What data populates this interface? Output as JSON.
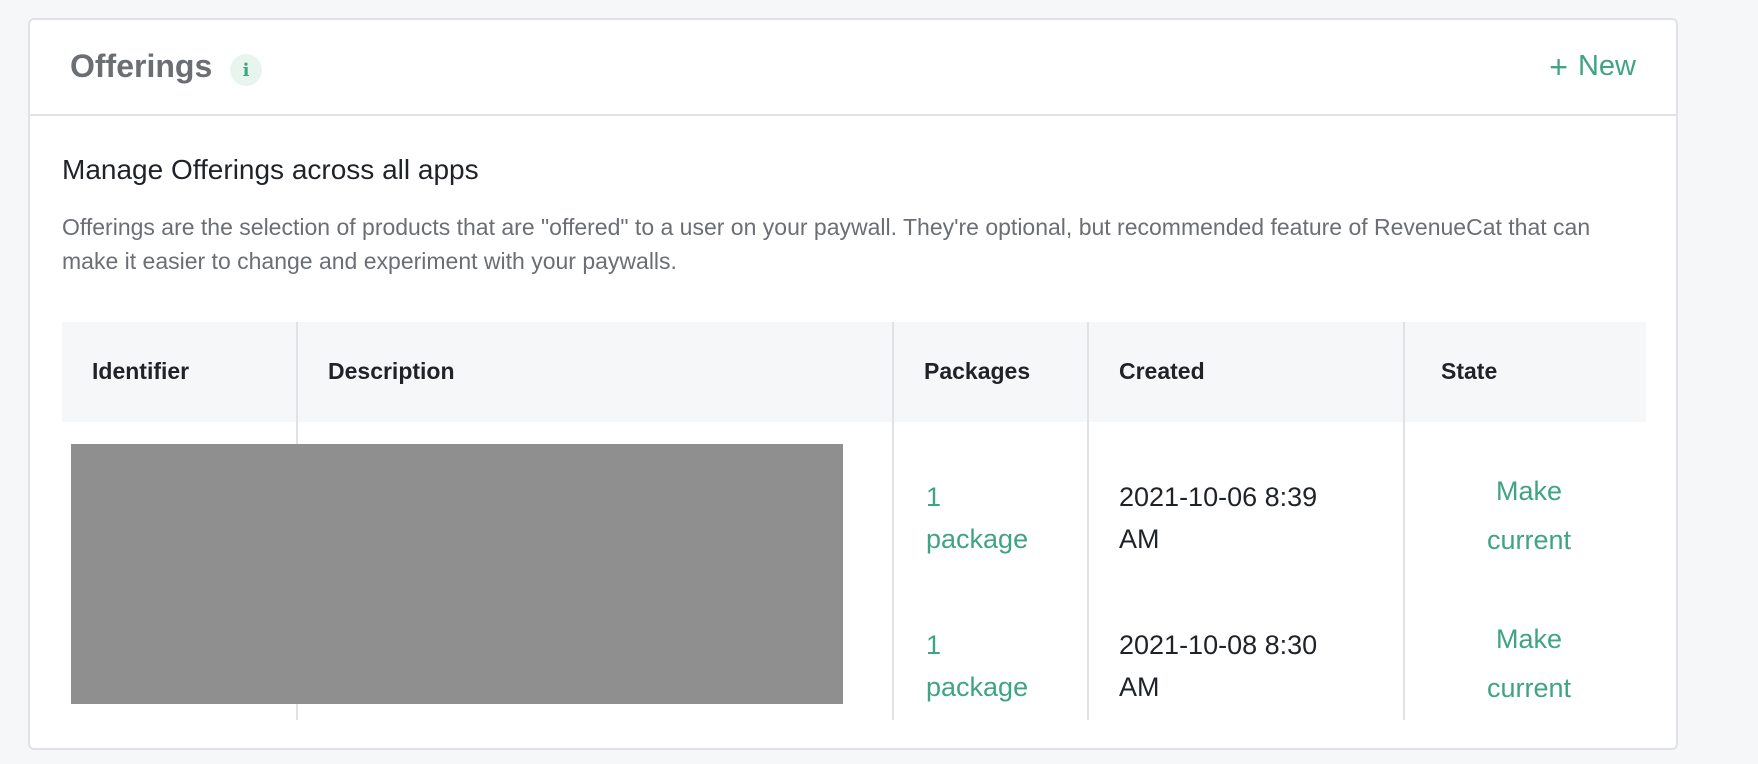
{
  "header": {
    "title": "Offerings",
    "info_icon": "info-icon",
    "info_glyph": "i",
    "new_button_icon": "plus-icon",
    "new_button_label": "New"
  },
  "intro": {
    "heading": "Manage Offerings across all apps",
    "description": "Offerings are the selection of products that are \"offered\" to a user on your paywall. They're optional, but recommended feature of RevenueCat that can make it easier to change and experiment with your paywalls."
  },
  "table": {
    "columns": [
      "Identifier",
      "Description",
      "Packages",
      "Created",
      "State"
    ],
    "rows": [
      {
        "packages_line1": "1",
        "packages_line2": "package",
        "created_line1": "2021-10-06 8:39",
        "created_line2": "AM",
        "state_line1": "Make",
        "state_line2": "current"
      },
      {
        "packages_line1": "1",
        "packages_line2": "package",
        "created_line1": "2021-10-08 8:30",
        "created_line2": "AM",
        "state_line1": "Make",
        "state_line2": "current"
      }
    ]
  },
  "colors": {
    "accent": "#3fa482",
    "title_gray": "#6b6f74",
    "border": "#e0e2e6",
    "redaction": "#8f8f8f"
  }
}
